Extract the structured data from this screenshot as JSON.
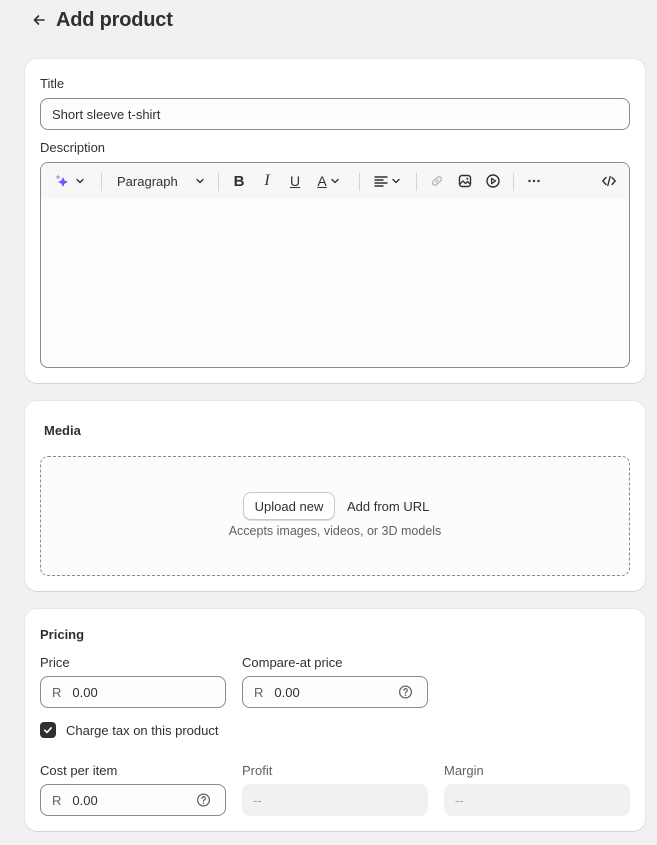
{
  "header": {
    "back_icon": "arrow-left-icon",
    "title": "Add product"
  },
  "product_card": {
    "title_label": "Title",
    "title_value": "Short sleeve t-shirt",
    "description_label": "Description",
    "toolbar": {
      "ai_icon": "sparkle-icon",
      "format_select": "Paragraph",
      "bold_icon": "bold-icon",
      "italic_icon": "italic-icon",
      "underline_icon": "underline-icon",
      "text_color_icon": "text-color-icon",
      "align_icon": "align-left-icon",
      "link_icon": "link-icon",
      "image_icon": "image-icon",
      "video_icon": "play-circle-icon",
      "more_icon": "more-horizontal-icon",
      "code_icon": "code-icon"
    },
    "description_value": ""
  },
  "media_card": {
    "heading": "Media",
    "upload_button": "Upload new",
    "add_from_url": "Add from URL",
    "hint": "Accepts images, videos, or 3D models"
  },
  "pricing_card": {
    "heading": "Pricing",
    "price_label": "Price",
    "price_prefix": "R",
    "price_value": "0.00",
    "compare_label": "Compare-at price",
    "compare_prefix": "R",
    "compare_value": "0.00",
    "charge_tax_label": "Charge tax on this product",
    "charge_tax_checked": true,
    "cost_label": "Cost per item",
    "cost_prefix": "R",
    "cost_value": "0.00",
    "profit_label": "Profit",
    "profit_value": "--",
    "margin_label": "Margin",
    "margin_value": "--"
  },
  "colors": {
    "page_bg": "#f1f1f1",
    "card_bg": "#ffffff",
    "text": "#303030",
    "muted_text": "#616161",
    "ai_accent": "#8051ff",
    "checkbox": "#303030"
  }
}
